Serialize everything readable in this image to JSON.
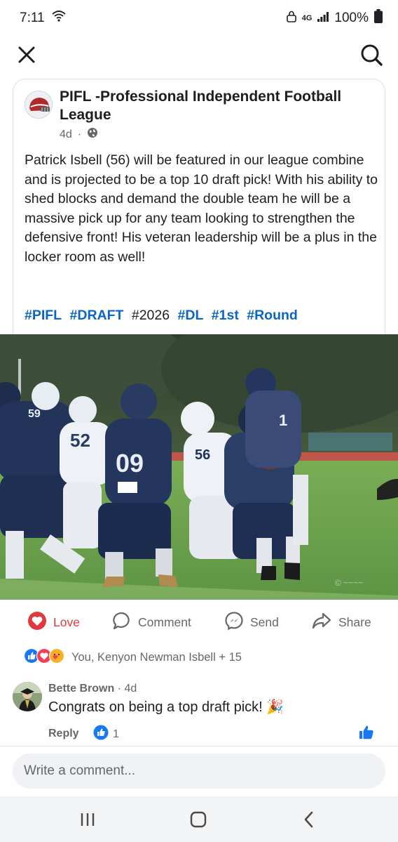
{
  "status": {
    "time": "7:11",
    "network": "4G",
    "battery": "100%"
  },
  "icons": {
    "close": "close-icon",
    "search": "search-icon",
    "globe": "globe-icon",
    "love": "heart-icon",
    "comment": "comment-icon",
    "send": "messenger-icon",
    "share": "share-icon"
  },
  "post": {
    "page_name": "PIFL -Professional Independent Football League",
    "time_ago": "4d",
    "separator": "·",
    "body": "Patrick Isbell (56) will be featured in our league combine and is projected to be a top 10 draft pick! With his ability to shed blocks and demand the double team he will be a massive pick up for any team looking to strengthen the defensive front! His veteran leadership will be a plus in the locker room as well!",
    "hashtags": [
      "#PIFL",
      "#DRAFT",
      "#2026",
      "#DL",
      "#1st",
      "#Round"
    ]
  },
  "actions": {
    "love": "Love",
    "comment": "Comment",
    "send": "Send",
    "share": "Share"
  },
  "reactions": {
    "summary": "You, Kenyon Newman Isbell + 15"
  },
  "comment": {
    "author": "Bette Brown",
    "time_ago": "4d",
    "text": "Congrats on being a top draft pick! 🎉",
    "reply": "Reply",
    "like_count": "1"
  },
  "composer": {
    "placeholder": "Write a comment..."
  },
  "colors": {
    "link": "#0a66c2",
    "love": "#e03a3e",
    "like": "#1877f2"
  }
}
